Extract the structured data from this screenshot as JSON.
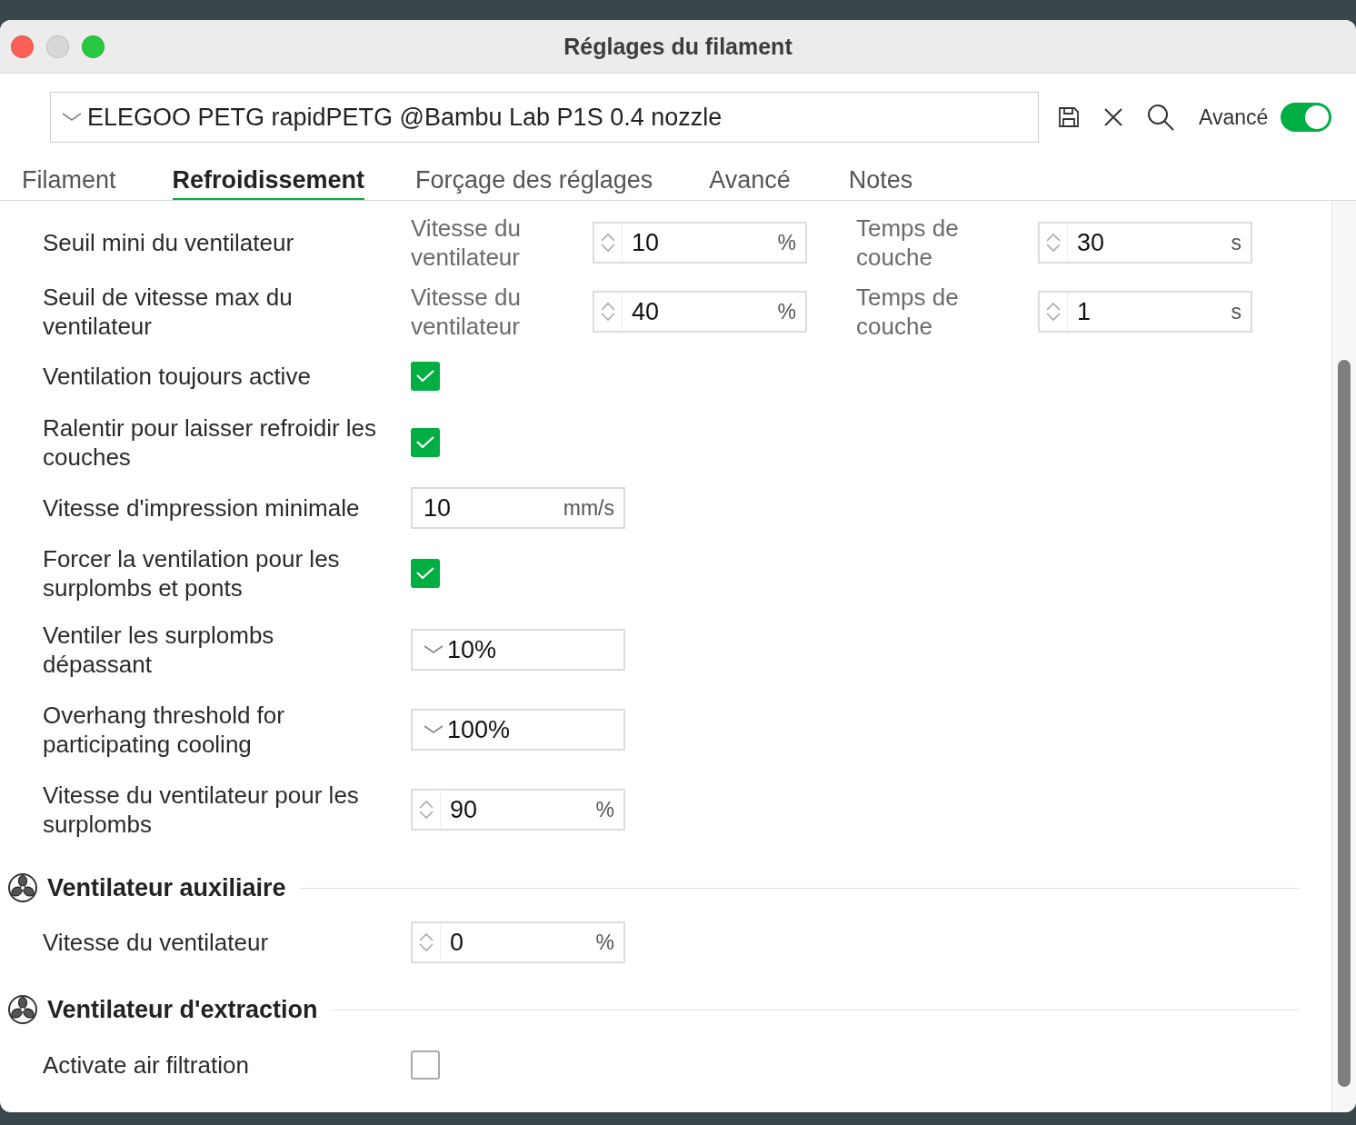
{
  "window": {
    "title": "Réglages du filament"
  },
  "toolbar": {
    "preset": "ELEGOO PETG rapidPETG @Bambu Lab P1S 0.4 nozzle",
    "advanced_label": "Avancé",
    "advanced_on": true
  },
  "tabs": [
    {
      "label": "Filament",
      "selected": false
    },
    {
      "label": "Refroidissement",
      "selected": true
    },
    {
      "label": "Forçage des réglages",
      "selected": false
    },
    {
      "label": "Avancé",
      "selected": false
    },
    {
      "label": "Notes",
      "selected": false
    }
  ],
  "groups": [
    {
      "rows": [
        {
          "kind": "pair",
          "label": "Seuil mini du ventilateur",
          "fields": [
            {
              "label": "Vitesse du ventilateur",
              "value": "10",
              "unit": "%"
            },
            {
              "label": "Temps de couche",
              "value": "30",
              "unit": "s"
            }
          ]
        },
        {
          "kind": "pair",
          "label": "Seuil de vitesse max du ventilateur",
          "fields": [
            {
              "label": "Vitesse du ventilateur",
              "value": "40",
              "unit": "%"
            },
            {
              "label": "Temps de couche",
              "value": "1",
              "unit": "s"
            }
          ]
        },
        {
          "kind": "checkbox",
          "label": "Ventilation toujours active",
          "checked": true
        },
        {
          "kind": "checkbox",
          "label": "Ralentir pour laisser refroidir les couches",
          "checked": true
        },
        {
          "kind": "input",
          "label": "Vitesse d'impression minimale",
          "value": "10",
          "unit": "mm/s"
        },
        {
          "kind": "checkbox",
          "label": "Forcer la ventilation pour les surplombs et ponts",
          "checked": true
        },
        {
          "kind": "dropdown",
          "label": "Ventiler les surplombs dépassant",
          "value": "10%"
        },
        {
          "kind": "dropdown",
          "label": "Overhang threshold for participating cooling",
          "value": "100%"
        },
        {
          "kind": "spinner",
          "label": "Vitesse du ventilateur pour les surplombs",
          "value": "90",
          "unit": "%"
        }
      ]
    },
    {
      "title": "Ventilateur auxiliaire",
      "rows": [
        {
          "kind": "spinner",
          "label": "Vitesse du ventilateur",
          "value": "0",
          "unit": "%"
        }
      ]
    },
    {
      "title": "Ventilateur d'extraction",
      "rows": [
        {
          "kind": "checkbox",
          "label": "Activate air filtration",
          "checked": false
        }
      ]
    }
  ]
}
